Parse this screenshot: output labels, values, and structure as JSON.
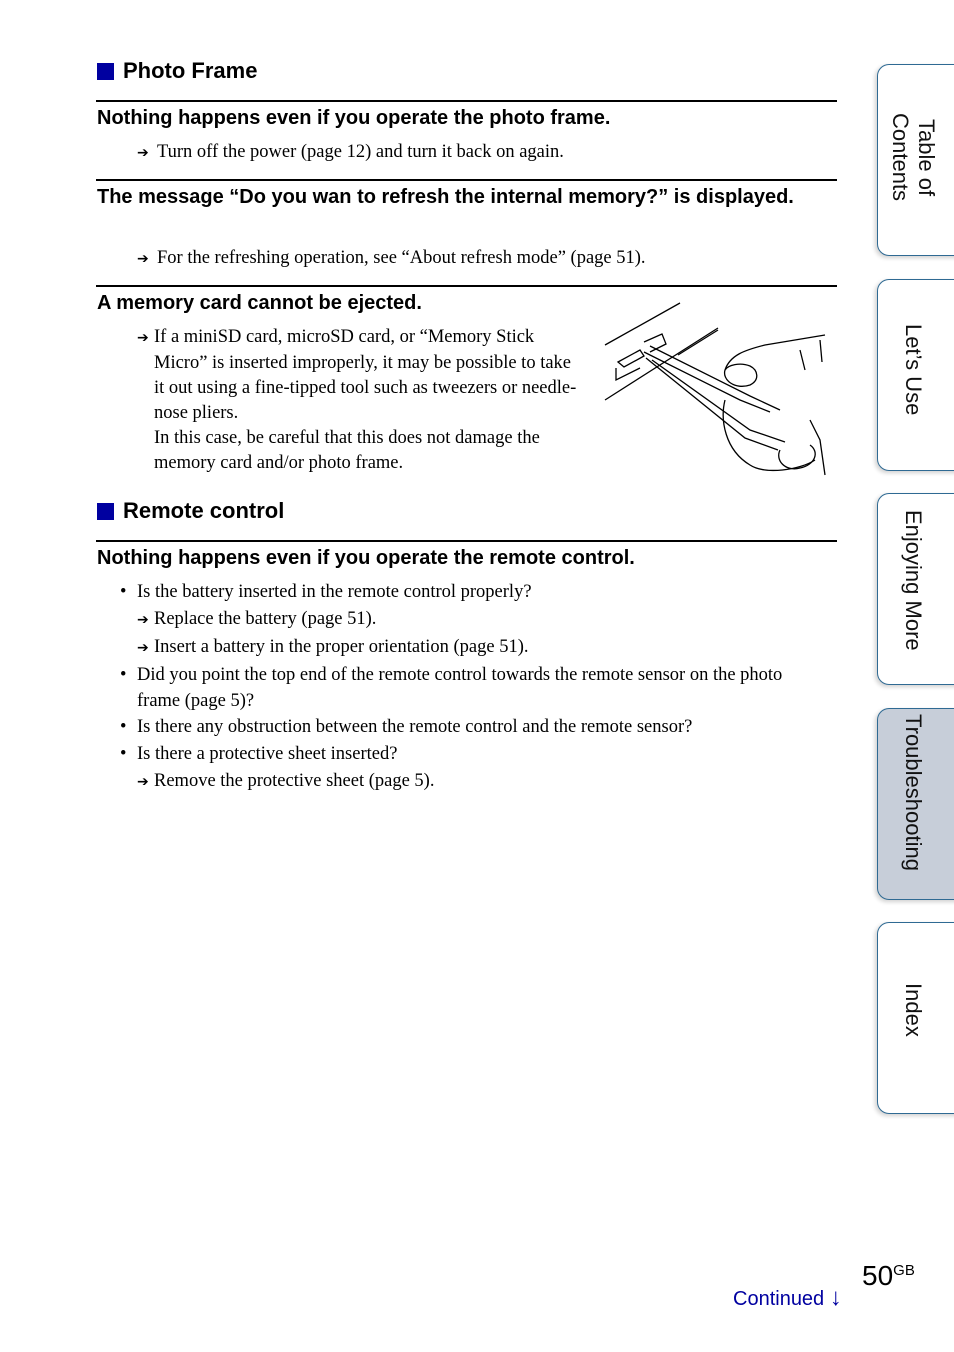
{
  "colors": {
    "accent": "#0000a0",
    "tab_border": "#2f6a93",
    "tab_active_bg": "#c7ced9"
  },
  "sections": [
    {
      "title": "Photo Frame",
      "icon": "square-bullet-icon",
      "items": [
        {
          "question": "Nothing happens even if you operate the photo frame.",
          "answers": [
            "Turn off the power (page 12) and turn it back on again."
          ]
        },
        {
          "question": "The message “Do you wan to refresh the internal memory?” is displayed.",
          "answers": [
            "For the refreshing operation, see “About refresh mode” (page 51)."
          ]
        },
        {
          "question": "A memory card cannot be ejected.",
          "answers": [
            "If a miniSD card, microSD card, or “Memory Stick Micro” is inserted improperly, it may be possible to take it out using a fine-tipped tool such as tweezers or needle-nose pliers.",
            "In this case, be careful that this does not damage the memory card and/or photo frame."
          ],
          "illustration": "tweezers-removing-card-illustration"
        }
      ]
    },
    {
      "title": "Remote control",
      "icon": "square-bullet-icon",
      "items": [
        {
          "question": "Nothing happens even if you operate the remote control.",
          "bullets": [
            {
              "text": "Is the battery inserted in the remote control properly?",
              "answers": [
                "Replace the battery (page 51).",
                "Insert a battery in the proper orientation (page 51)."
              ]
            },
            {
              "text": "Did you point the top end of the remote control towards the remote sensor on the photo frame (page 5)?",
              "answers": []
            },
            {
              "text": "Is there any obstruction between the remote control and the remote sensor?",
              "answers": []
            },
            {
              "text": "Is there a protective sheet inserted?",
              "answers": [
                "Remove the protective sheet (page 5)."
              ]
            }
          ]
        }
      ]
    }
  ],
  "symbols": {
    "arrow": "➔",
    "bullet": "•",
    "down_arrow": "↓"
  },
  "tabs": [
    {
      "label": "Table of\nContents",
      "active": false
    },
    {
      "label": "Let’s Use",
      "active": false
    },
    {
      "label": "Enjoying More",
      "active": false
    },
    {
      "label": "Troubleshooting",
      "active": true
    },
    {
      "label": "Index",
      "active": false
    }
  ],
  "footer": {
    "continued": "Continued",
    "page_number": "50",
    "page_suffix": "GB"
  }
}
